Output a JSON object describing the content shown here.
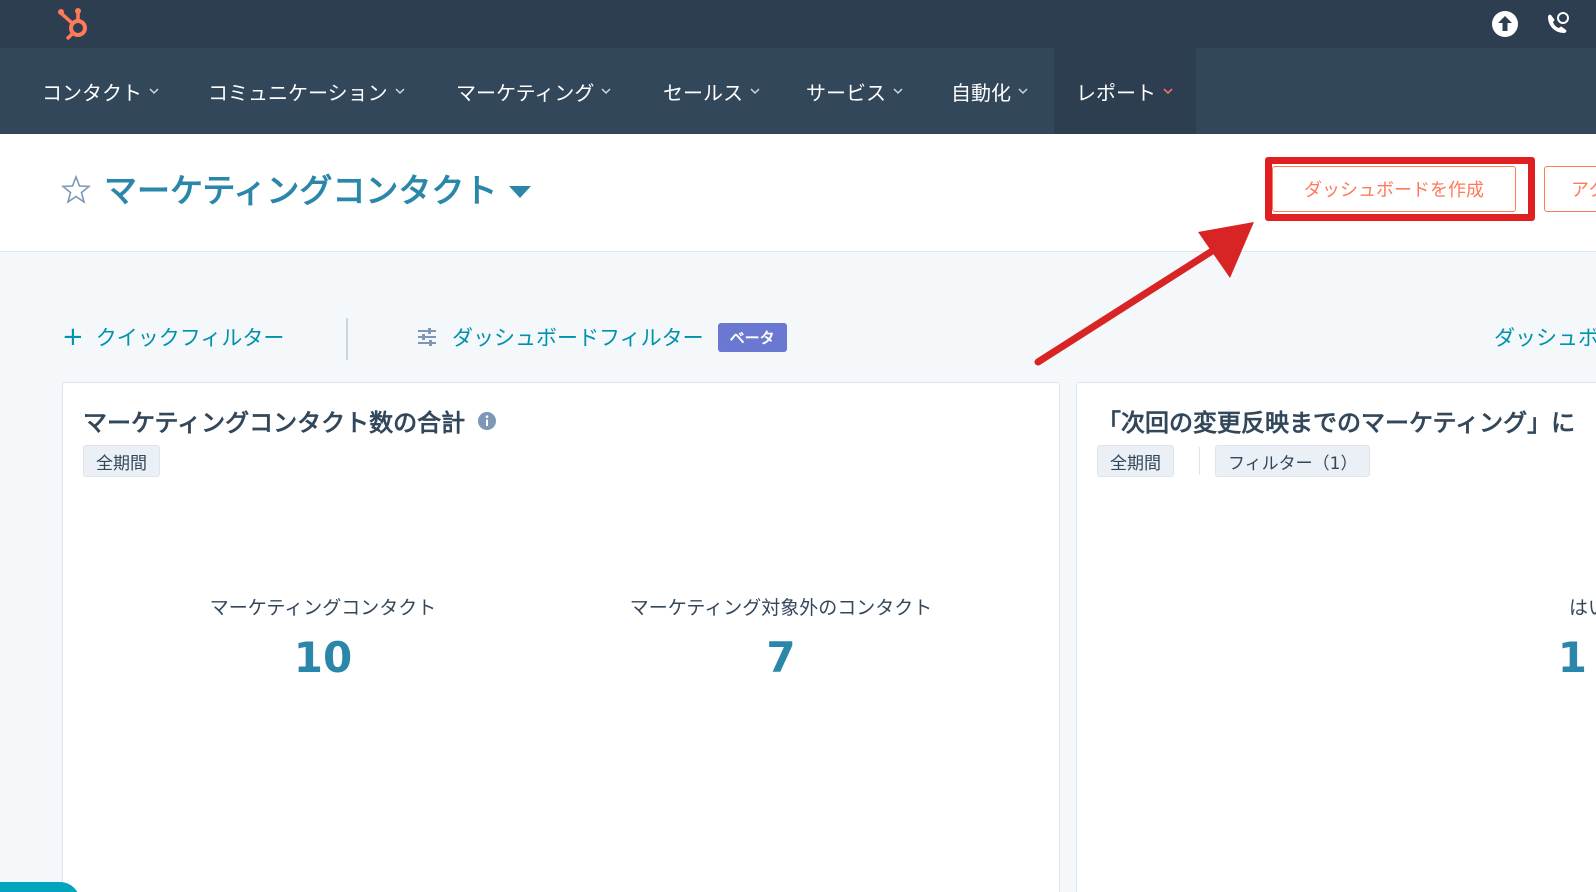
{
  "nav": {
    "items": [
      "コンタクト",
      "コミュニケーション",
      "マーケティング",
      "セールス",
      "サービス",
      "自動化",
      "レポート"
    ]
  },
  "header": {
    "title": "マーケティングコンタクト",
    "create_button": "ダッシュボードを作成",
    "action_button": "アク"
  },
  "filters": {
    "quick": "クイックフィルター",
    "dashboard": "ダッシュボードフィルター",
    "beta": "ベータ",
    "right_link": "ダッシュボ"
  },
  "cards": [
    {
      "title": "マーケティングコンタクト数の合計",
      "tags": [
        "全期間"
      ],
      "kpis": [
        {
          "label": "マーケティングコンタクト",
          "value": "10"
        },
        {
          "label": "マーケティング対象外のコンタクト",
          "value": "7"
        }
      ]
    },
    {
      "title": "「次回の変更反映までのマーケティング」に",
      "tags": [
        "全期間",
        "フィルター（1）"
      ],
      "kpis": [
        {
          "label": "はい",
          "value": "1"
        }
      ]
    }
  ],
  "colors": {
    "topbar": "#2d3e50",
    "navbar": "#33475b",
    "accent": "#ff7a59",
    "link": "#0091ae",
    "highlight": "#e02020",
    "kpi": "#2b87aa"
  }
}
